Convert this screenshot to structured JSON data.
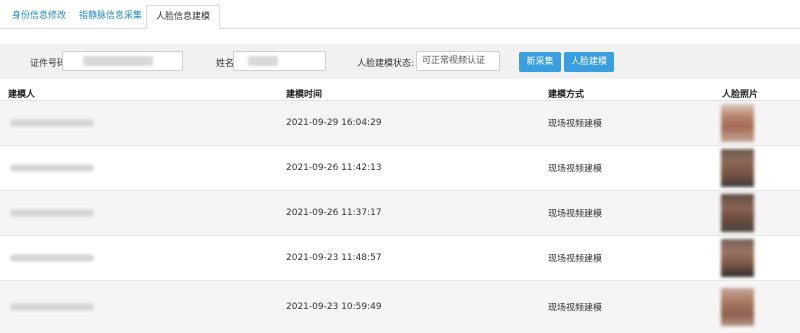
{
  "tabs": [
    {
      "label": "身份信息修改"
    },
    {
      "label": "指静脉信息采集"
    },
    {
      "label": "人脸信息建模"
    }
  ],
  "filter": {
    "id_label": "证件号码",
    "name_label": "姓名",
    "status_label": "人脸建模状态:",
    "status_value": "可正常视频认证",
    "btn_new": "新采集",
    "btn_model": "人脸建模"
  },
  "table": {
    "headers": [
      "建模人",
      "建模时间",
      "建模方式",
      "人脸照片"
    ],
    "rows": [
      {
        "time": "2021-09-29 16:04:29",
        "method": "现场视频建模"
      },
      {
        "time": "2021-09-26 11:42:13",
        "method": "现场视频建模"
      },
      {
        "time": "2021-09-26 11:37:17",
        "method": "现场视频建模"
      },
      {
        "time": "2021-09-23 11:48:57",
        "method": "现场视频建模"
      },
      {
        "time": "2021-09-23 10:59:49",
        "method": "现场视频建模"
      }
    ]
  }
}
